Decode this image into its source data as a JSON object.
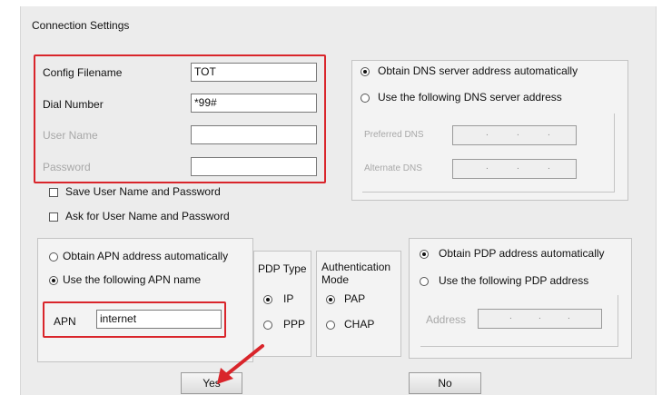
{
  "dialog": {
    "title": "Connection Settings"
  },
  "connection": {
    "config_filename_label": "Config Filename",
    "config_filename_value": "TOT",
    "dial_number_label": "Dial Number",
    "dial_number_value": "*99#",
    "user_name_label": "User Name",
    "user_name_value": "",
    "password_label": "Password",
    "password_value": "",
    "save_credentials_label": "Save User Name and Password",
    "ask_credentials_label": "Ask for User Name and Password"
  },
  "dns": {
    "auto_label": "Obtain DNS server address automatically",
    "manual_label": "Use the following DNS server address",
    "preferred_label": "Preferred DNS",
    "alternate_label": "Alternate DNS",
    "selected": "auto"
  },
  "apn": {
    "auto_label": "Obtain APN address automatically",
    "manual_label": "Use the following APN name",
    "apn_label": "APN",
    "apn_value": "internet",
    "selected": "manual"
  },
  "pdp_type": {
    "title": "PDP Type",
    "ip_label": "IP",
    "ppp_label": "PPP",
    "selected": "IP"
  },
  "auth": {
    "title_line1": "Authentication",
    "title_line2": "Mode",
    "pap_label": "PAP",
    "chap_label": "CHAP",
    "selected": "PAP"
  },
  "pdp_address": {
    "auto_label": "Obtain PDP address automatically",
    "manual_label": "Use the following PDP address",
    "address_label": "Address",
    "selected": "auto"
  },
  "buttons": {
    "yes_label": "Yes",
    "no_label": "No"
  },
  "annotation": {
    "highlight_color": "#d9252b"
  }
}
